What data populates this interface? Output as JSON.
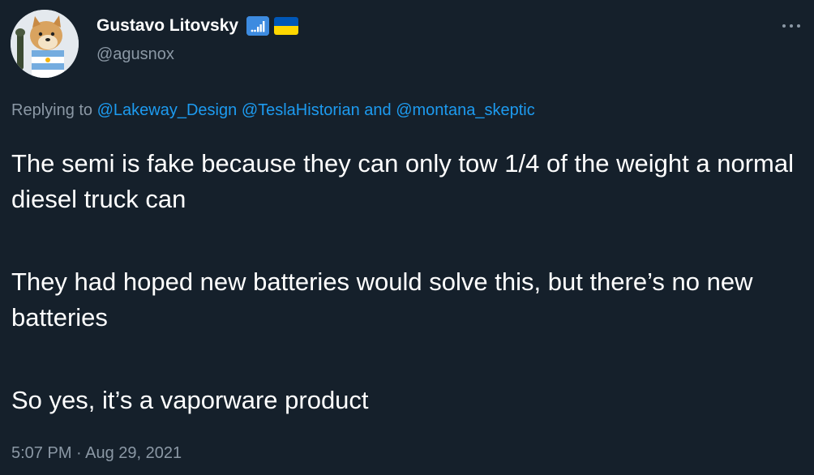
{
  "author": {
    "display_name": "Gustavo Litovsky",
    "handle": "@agusnox",
    "badge_icon": "signal-bars-badge-icon",
    "flag_icon": "ukraine-flag-icon",
    "badge_color": "#3d8be0",
    "flag_colors": [
      "#0057b7",
      "#ffd700"
    ]
  },
  "more_icon": "more-dots-icon",
  "reply": {
    "prefix": "Replying to ",
    "mention_1": "@Lakeway_Design",
    "mention_2": "@TeslaHistorian",
    "conjunction": " and ",
    "mention_3": "@montana_skeptic"
  },
  "tweet": {
    "para_1": "The semi is fake because they can only tow 1/4 of the weight a normal diesel truck can",
    "para_2": "They had hoped new batteries would solve this, but there’s no new batteries",
    "para_3": "So yes, it’s a vaporware product"
  },
  "meta": {
    "time": "5:07 PM",
    "separator": " · ",
    "date": "Aug 29, 2021"
  },
  "colors": {
    "background": "#15202b",
    "text": "#ffffff",
    "secondary": "#8b98a5",
    "link": "#1d9bf0"
  }
}
